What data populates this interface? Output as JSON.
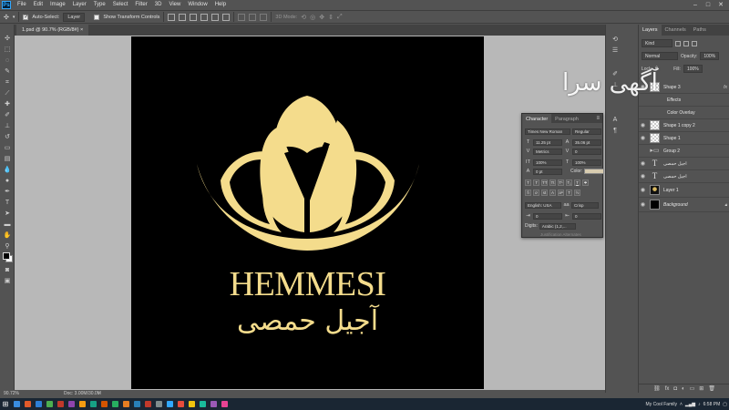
{
  "app": {
    "logo": "Ps"
  },
  "menu": [
    "File",
    "Edit",
    "Image",
    "Layer",
    "Type",
    "Select",
    "Filter",
    "3D",
    "View",
    "Window",
    "Help"
  ],
  "options_bar": {
    "auto_select_label": "Auto-Select:",
    "auto_select_value": "Layer",
    "show_transform_label": "Show Transform Controls",
    "mode_3d_label": "3D Mode:"
  },
  "document": {
    "tab_title": "1.psd @ 90.7% (RGB/8#)"
  },
  "status": {
    "zoom": "90.72%",
    "doc_size": "Doc: 3.00M/30.0M"
  },
  "artwork": {
    "brand_en": "HEMMESI",
    "brand_ar": "آجیل حمصی",
    "gold_color": "#f4dc8c"
  },
  "watermark": "آگهی سرا",
  "layers_panel": {
    "tabs": [
      "Layers",
      "Channels",
      "Paths"
    ],
    "filter_label": "Kind",
    "blend_mode": "Normal",
    "opacity_label": "Opacity:",
    "opacity_value": "100%",
    "lock_label": "Lock:",
    "fill_label": "Fill:",
    "fill_value": "100%",
    "layers": [
      {
        "name": "Shape 3",
        "thumb": "checker",
        "fx": "fx"
      },
      {
        "name": "Effects",
        "thumb": "none",
        "fx": ""
      },
      {
        "name": "Color Overlay",
        "thumb": "none",
        "fx": ""
      },
      {
        "name": "Shape 1 copy 2",
        "thumb": "checker",
        "fx": ""
      },
      {
        "name": "Shape 1",
        "thumb": "checker",
        "fx": ""
      },
      {
        "name": "Group 2",
        "thumb": "folder",
        "fx": ""
      },
      {
        "name": "آجیل حمصی",
        "thumb": "type",
        "fx": ""
      },
      {
        "name": "آجیل حمصی",
        "thumb": "type",
        "fx": ""
      },
      {
        "name": "Layer 1",
        "thumb": "dark",
        "fx": ""
      },
      {
        "name": "Background",
        "thumb": "black",
        "fx": ""
      }
    ]
  },
  "character_panel": {
    "tabs": [
      "Character",
      "Paragraph"
    ],
    "font_family": "Times New Roman",
    "font_style": "Regular",
    "size": "11.25 pt",
    "leading": "35.06 pt",
    "kerning": "Metrics",
    "tracking": "0",
    "vertical_scale": "100%",
    "horizontal_scale": "100%",
    "baseline": "0 pt",
    "color_label": "Color:",
    "color_value": "#d8ccb0",
    "language": "English: USA",
    "antialias": "Crisp",
    "indent_left": "0",
    "indent_right": "0",
    "digits_label": "Digits:",
    "digits_value": "Arabic (1,2,...",
    "justification": "Justification Alternates"
  },
  "taskbar": {
    "user_label": "My Cool Family",
    "time": "6:58 PM",
    "app_colors": [
      "#3a8de0",
      "#e05a2a",
      "#2d7fd6",
      "#4caf50",
      "#c0392b",
      "#8e44ad",
      "#f39c12",
      "#16a085",
      "#d35400",
      "#27ae60",
      "#e67e22",
      "#2980b9",
      "#c0392b",
      "#7f8c8d",
      "#31a8ff",
      "#e74c3c",
      "#f1c40f",
      "#1abc9c",
      "#9b59b6",
      "#e84393"
    ]
  }
}
